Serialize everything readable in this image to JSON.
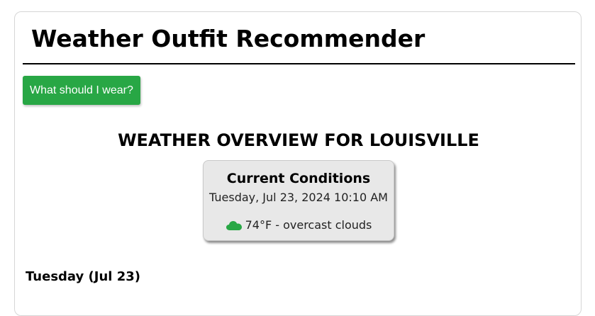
{
  "app": {
    "title": "Weather Outfit Recommender"
  },
  "actions": {
    "wear_button_label": "What should I wear?"
  },
  "overview": {
    "title": "WEATHER OVERVIEW FOR LOUISVILLE",
    "current": {
      "heading": "Current Conditions",
      "datetime": "Tuesday, Jul 23, 2024 10:10 AM",
      "summary": "74°F - overcast clouds",
      "icon": "cloud-icon"
    }
  },
  "forecast": {
    "days": [
      {
        "label": "Tuesday (Jul 23)"
      }
    ]
  },
  "colors": {
    "button": "#28a745",
    "icon": "#28a745",
    "conditions_bg": "#e8e8e8"
  }
}
